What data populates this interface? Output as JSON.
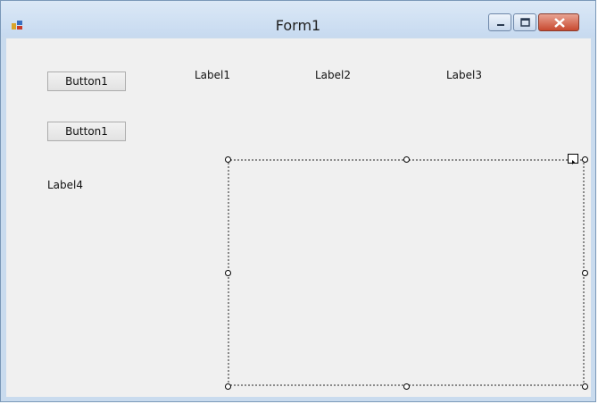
{
  "window": {
    "title": "Form1"
  },
  "controls": {
    "button1_top": "Button1",
    "button1_bottom": "Button1",
    "label1": "Label1",
    "label2": "Label2",
    "label3": "Label3",
    "label4": "Label4"
  },
  "icons": {
    "app": "form-app-icon",
    "minimize": "minimize-icon",
    "maximize": "maximize-icon",
    "close": "close-icon",
    "smart_tag": "smart-tag-icon"
  },
  "colors": {
    "titlebar": "#c7daf0",
    "client_bg": "#f0f0f0",
    "close_red": "#c84a30"
  }
}
